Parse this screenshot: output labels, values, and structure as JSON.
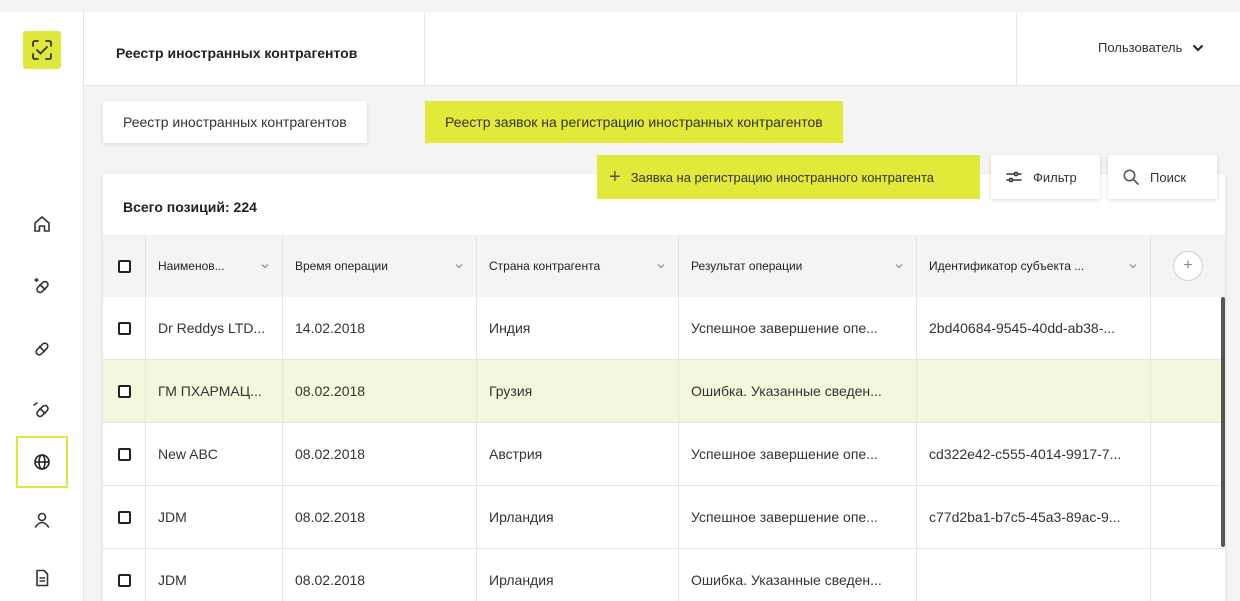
{
  "header": {
    "title": "Реестр иностранных контрагентов",
    "user_label": "Пользователь"
  },
  "tabs": [
    {
      "label": "Реестр иностранных контрагентов",
      "active": false
    },
    {
      "label": "Реестр заявок на регистрацию иностранных контрагентов",
      "active": true
    }
  ],
  "actions": {
    "add_label": "Заявка на регистрацию иностранного контрагента",
    "filter_label": "Фильтр",
    "search_label": "Поиск"
  },
  "table": {
    "total_label": "Всего позиций: 224",
    "columns": [
      "Наименов...",
      "Время операции",
      "Страна контрагента",
      "Результат операции",
      "Идентификатор субъекта ..."
    ],
    "rows": [
      {
        "name": "Dr Reddys LTD...",
        "time": "14.02.2018",
        "country": "Индия",
        "result": "Успешное завершение опе...",
        "id": "2bd40684-9545-40dd-ab38-..."
      },
      {
        "name": "ГМ ПХАРМАЦ...",
        "time": "08.02.2018",
        "country": "Грузия",
        "result": "Ошибка. Указанные сведен...",
        "id": ""
      },
      {
        "name": "New ABC",
        "time": "08.02.2018",
        "country": "Австрия",
        "result": "Успешное завершение опе...",
        "id": "cd322e42-c555-4014-9917-7..."
      },
      {
        "name": "JDM",
        "time": "08.02.2018",
        "country": "Ирландия",
        "result": "Успешное завершение опе...",
        "id": "c77d2ba1-b7c5-45a3-89ac-9..."
      },
      {
        "name": "JDM",
        "time": "08.02.2018",
        "country": "Ирландия",
        "result": "Ошибка. Указанные сведен...",
        "id": ""
      }
    ],
    "highlight_row": 1
  },
  "nav": {
    "items": [
      {
        "icon": "home-icon"
      },
      {
        "icon": "pills-icon"
      },
      {
        "icon": "capsule-icon"
      },
      {
        "icon": "pills-alt-icon"
      },
      {
        "icon": "globe-icon",
        "active": true
      },
      {
        "icon": "user-icon"
      },
      {
        "icon": "document-icon"
      }
    ]
  },
  "colors": {
    "accent": "#e1ea38",
    "highlight_row": "#f5f7dc",
    "header_bg": "#f4f4f4"
  }
}
